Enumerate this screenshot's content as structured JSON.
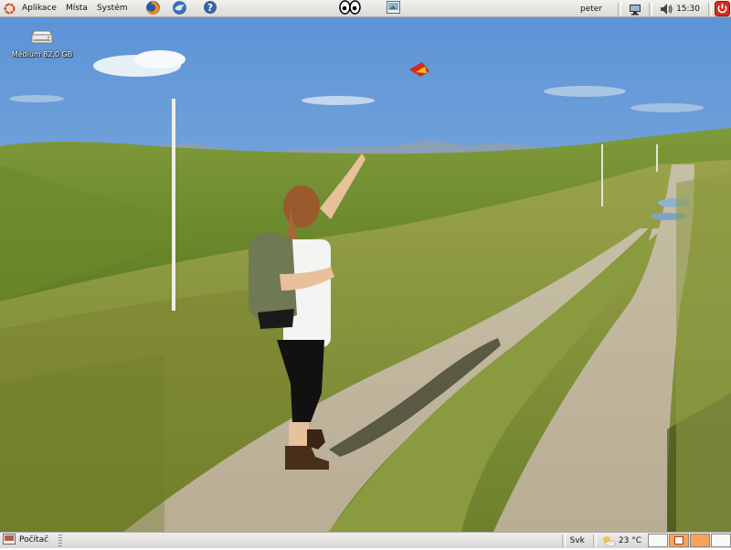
{
  "top_panel": {
    "menu": [
      {
        "label": "Aplikace",
        "icon": "ubuntu-logo-icon"
      },
      {
        "label": "Místa"
      },
      {
        "label": "Systém"
      }
    ],
    "launchers": [
      "firefox-icon",
      "thunderbird-icon",
      "help-icon"
    ],
    "center_applets": [
      "xeyes-icon",
      "screenshot-icon"
    ],
    "user": "peter",
    "clock": "15:30",
    "tray_icons": [
      "network-monitor-icon",
      "volume-icon",
      "shutdown-icon"
    ]
  },
  "desktop": {
    "icons": [
      {
        "label": "Médium 82,0 GB",
        "icon": "harddisk-icon"
      }
    ]
  },
  "bottom_panel": {
    "task_label": "Počítač",
    "keyboard_layout": "Svk",
    "weather": "23 °C",
    "weather_icon": "weather-sun-cloud-icon",
    "colors": {
      "workspace_active": "#f6a25a",
      "workspace_inactive": "#f8f8f8"
    }
  }
}
